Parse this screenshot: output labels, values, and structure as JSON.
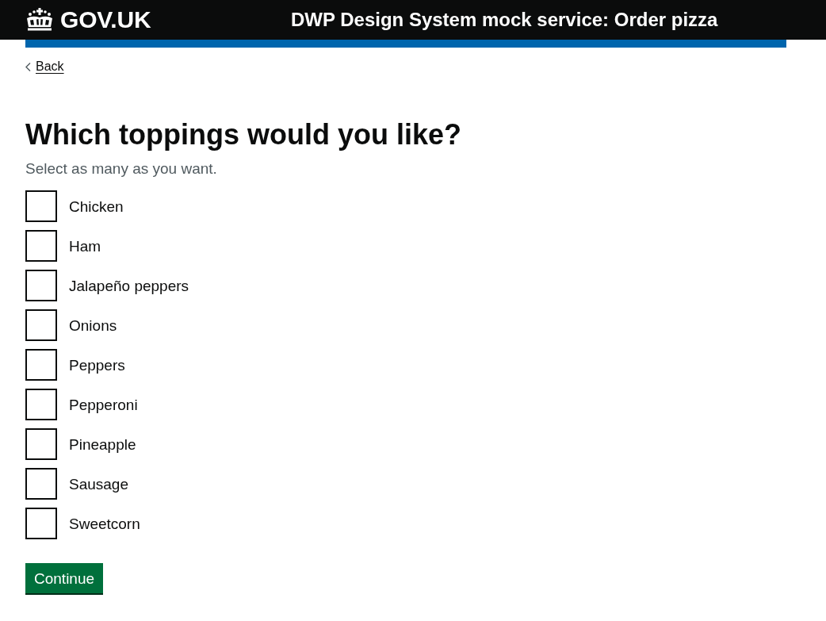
{
  "header": {
    "logo": "GOV.UK",
    "service_name": "DWP Design System mock service: Order pizza"
  },
  "back_link": "Back",
  "question": {
    "heading": "Which toppings would you like?",
    "hint": "Select as many as you want.",
    "options": [
      {
        "label": "Chicken",
        "checked": false
      },
      {
        "label": "Ham",
        "checked": false
      },
      {
        "label": "Jalapeño peppers",
        "checked": false
      },
      {
        "label": "Onions",
        "checked": false
      },
      {
        "label": "Peppers",
        "checked": false
      },
      {
        "label": "Pepperoni",
        "checked": false
      },
      {
        "label": "Pineapple",
        "checked": false
      },
      {
        "label": "Sausage",
        "checked": false
      },
      {
        "label": "Sweetcorn",
        "checked": false
      }
    ]
  },
  "button": "Continue"
}
